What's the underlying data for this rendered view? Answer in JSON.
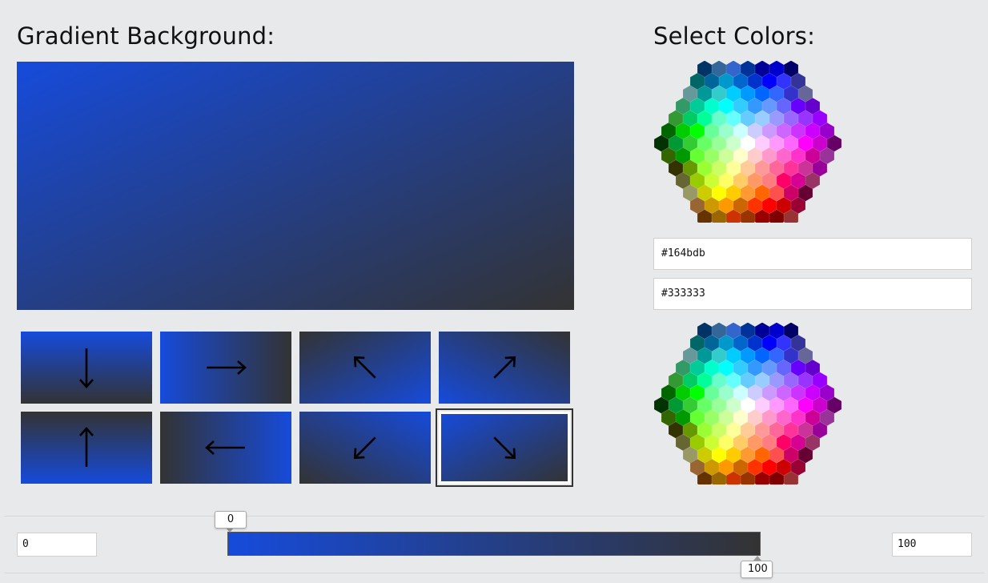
{
  "headings": {
    "gradient_background": "Gradient Background:",
    "select_colors": "Select Colors:"
  },
  "colors": {
    "start": "#164bdb",
    "end": "#333333"
  },
  "inputs": {
    "color_1": "#164bdb",
    "color_2": "#333333",
    "stop_start": "0",
    "stop_end": "100"
  },
  "slider": {
    "start_label": "0",
    "end_label": "100",
    "start_value": 0,
    "end_value": 100
  },
  "directions": [
    {
      "name": "to-bottom",
      "arrow": "↓",
      "selected": false
    },
    {
      "name": "to-right",
      "arrow": "→",
      "selected": false
    },
    {
      "name": "to-top-left",
      "arrow": "↖",
      "selected": false
    },
    {
      "name": "to-top-right",
      "arrow": "↗",
      "selected": false
    },
    {
      "name": "to-top",
      "arrow": "↑",
      "selected": false
    },
    {
      "name": "to-left",
      "arrow": "←",
      "selected": false
    },
    {
      "name": "to-bottom-left",
      "arrow": "↙",
      "selected": false
    },
    {
      "name": "to-bottom-right",
      "arrow": "↘",
      "selected": true
    }
  ],
  "selected_direction": "to-bottom-right"
}
